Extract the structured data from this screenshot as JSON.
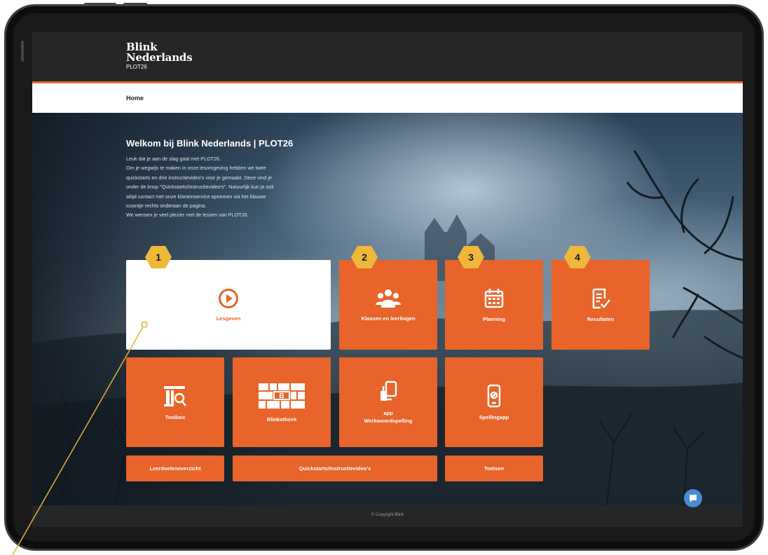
{
  "colors": {
    "accent": "#e8642a",
    "header": "#252627",
    "badge": "#f0b83a",
    "chat": "#4b8ad6"
  },
  "header": {
    "logo_line1": "Blink",
    "logo_line2": "Nederlands",
    "logo_sub": "PLOT26"
  },
  "nav": {
    "home": "Home"
  },
  "welcome": {
    "title": "Welkom bij Blink Nederlands | PLOT26",
    "lines": [
      "Leuk dat je aan de slag gaat met PLOT26.",
      "Om je wegwijs te maken in onze lesomgeving hebben we twee",
      "quickstarts en drie instructievideo's voor je gemaakt. Deze vind je",
      "onder de knop \"Quickstarts/Instructievideo's\". Natuurlijk kun je ook",
      "altijd contact met onze klantenservice opnemen via het blauwe",
      "icoontje rechts onderaan de pagina.",
      "We wensen je veel plezier met de lessen van PLOT26."
    ]
  },
  "tiles": {
    "lesgeven": {
      "label": "Lesgeven",
      "icon": "play-circle-icon"
    },
    "klassen": {
      "label": "Klassen en leerlingen",
      "icon": "group-icon"
    },
    "planning": {
      "label": "Planning",
      "icon": "calendar-icon"
    },
    "resultaten": {
      "label": "Resultaten",
      "icon": "checklist-icon"
    },
    "toolbox": {
      "label": "Toolbox",
      "icon": "toolbox-search-icon"
    },
    "blinkotheek": {
      "label": "Blinkotheek",
      "icon": "bookshelf-icon"
    },
    "werkwoordspelling": {
      "label_line1": "app",
      "label_line2": "Werkwoordspelling",
      "icon": "phone-copy-icon"
    },
    "spellingapp": {
      "label": "Spellingapp",
      "icon": "phone-icon"
    },
    "leerdoelen": {
      "label": "Leerdoelenoverzicht"
    },
    "quickstarts": {
      "label": "Quickstarts/Instructievideo's"
    },
    "toetsen": {
      "label": "Toetsen"
    }
  },
  "callouts": [
    "1",
    "2",
    "3",
    "4"
  ],
  "footer": {
    "copyright": "© Copyright Blink"
  },
  "chat": {
    "icon": "chat-icon"
  }
}
